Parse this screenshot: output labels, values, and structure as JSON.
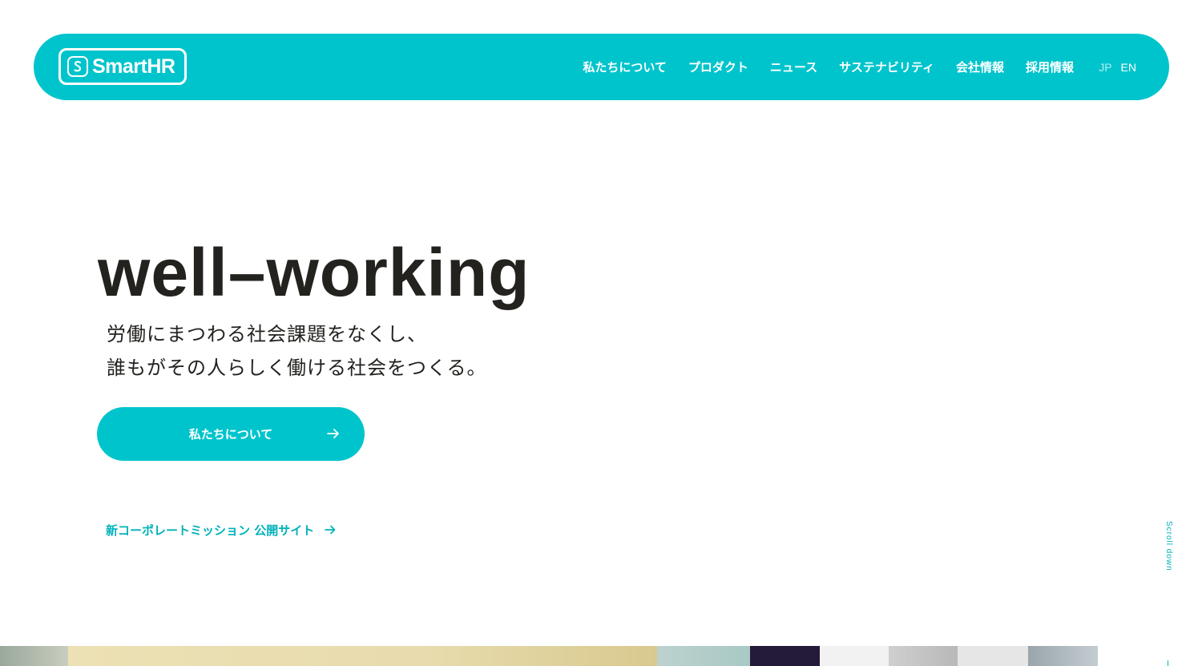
{
  "header": {
    "logo_text": "SmartHR",
    "nav": [
      "私たちについて",
      "プロダクト",
      "ニュース",
      "サステナビリティ",
      "会社情報",
      "採用情報"
    ],
    "lang": {
      "jp": "JP",
      "en": "EN"
    }
  },
  "hero": {
    "title": "well–working",
    "subtitle_line1": "労働にまつわる社会課題をなくし、",
    "subtitle_line2": "誰もがその人らしく働ける社会をつくる。",
    "cta_label": "私たちについて",
    "mission_link": "新コーポレートミッション 公開サイト"
  },
  "scroll_label": "Scroll down",
  "colors": {
    "brand": "#00c4cc",
    "link": "#00b2ba",
    "text": "#23221f",
    "background": "#ffffff"
  },
  "icons": {
    "cta": "arrow-right-icon",
    "mission": "arrow-right-icon",
    "logo": "smarthr-mark-icon"
  }
}
